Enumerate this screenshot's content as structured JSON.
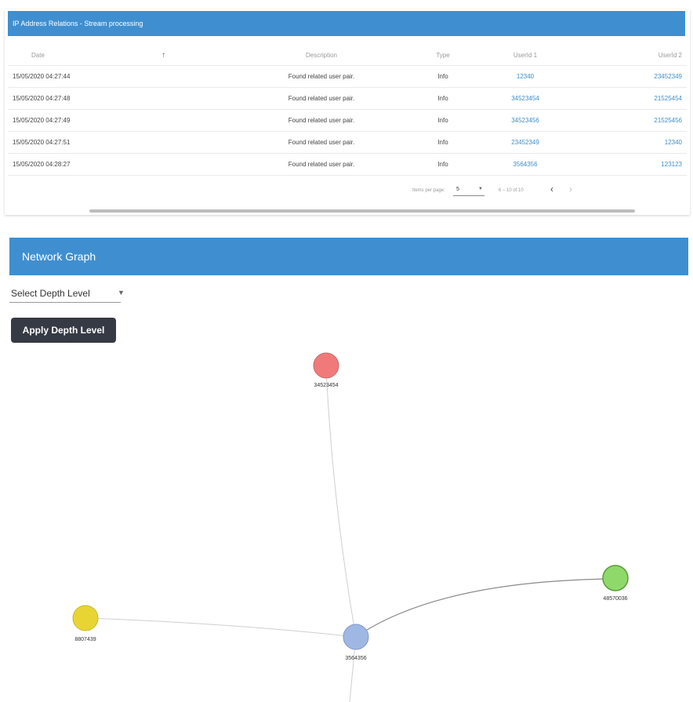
{
  "relations": {
    "title": "IP Address Relations - Stream processing",
    "columns": {
      "date": "Date",
      "sort_icon": "arrow-up-icon",
      "description": "Description",
      "type": "Type",
      "userid1": "UserId 1",
      "userid2": "UserId 2"
    },
    "rows": [
      {
        "date": "15/05/2020 04:27:44",
        "description": "Found related user pair.",
        "type": "Info",
        "userid1": "12340",
        "userid2": "23452349"
      },
      {
        "date": "15/05/2020 04:27:48",
        "description": "Found related user pair.",
        "type": "Info",
        "userid1": "34523454",
        "userid2": "21525454"
      },
      {
        "date": "15/05/2020 04:27:49",
        "description": "Found related user pair.",
        "type": "Info",
        "userid1": "34523456",
        "userid2": "21525456"
      },
      {
        "date": "15/05/2020 04:27:51",
        "description": "Found related user pair.",
        "type": "Info",
        "userid1": "23452349",
        "userid2": "12340"
      },
      {
        "date": "15/05/2020 04:28:27",
        "description": "Found related user pair.",
        "type": "Info",
        "userid1": "3564356",
        "userid2": "123123"
      }
    ],
    "paginator": {
      "items_label": "Items per page:",
      "page_size": "5",
      "range": "6 – 10 of 10",
      "prev_icon": "chevron-left-icon",
      "next_icon": "chevron-right-icon"
    }
  },
  "network": {
    "title": "Network Graph",
    "depth_select_label": "Select Depth Level",
    "apply_button": "Apply Depth Level",
    "nodes": [
      {
        "id": "34523454",
        "color": "#f07a7a"
      },
      {
        "id": "48570036",
        "color": "#8fd96a"
      },
      {
        "id": "8807439",
        "color": "#e8d534"
      },
      {
        "id": "3564356",
        "color": "#9fb8e3"
      }
    ]
  }
}
